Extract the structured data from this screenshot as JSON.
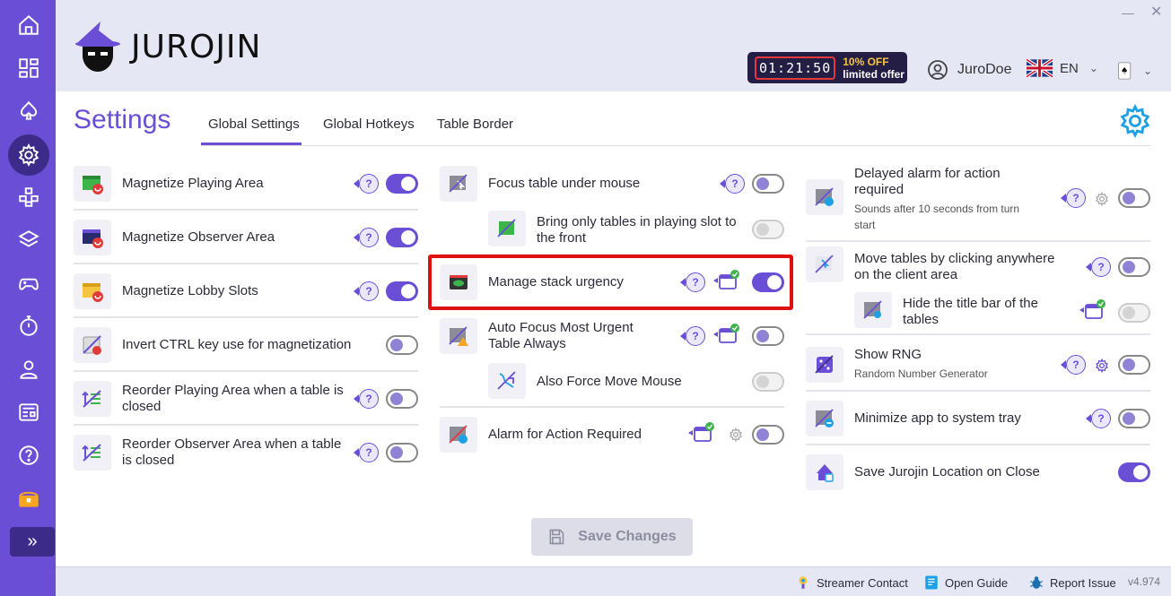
{
  "app": {
    "logo_text": "JUROJIN"
  },
  "window": {
    "minimize": "—",
    "close": "✕"
  },
  "promo": {
    "timer": "01:21:50",
    "discount": "10% OFF",
    "subtitle": "limited offer"
  },
  "user": {
    "name": "JuroDoe",
    "icon": "user-circle-icon"
  },
  "language": {
    "code": "EN",
    "flag": "uk-flag-icon",
    "chevron": "⌄"
  },
  "sidebar": {
    "items": [
      {
        "icon": "home-icon"
      },
      {
        "icon": "dashboard-icon"
      },
      {
        "icon": "spade-icon"
      },
      {
        "icon": "gear-icon",
        "active": true
      },
      {
        "icon": "layout-icon"
      },
      {
        "icon": "layers-icon"
      },
      {
        "icon": "gamepad-icon"
      },
      {
        "icon": "stopwatch-icon"
      },
      {
        "icon": "person-icon"
      },
      {
        "icon": "news-icon"
      },
      {
        "icon": "help-icon"
      },
      {
        "icon": "treasure-chest-icon"
      }
    ],
    "expand_label": "»"
  },
  "page": {
    "title": "Settings",
    "tabs": [
      {
        "label": "Global Settings",
        "active": true
      },
      {
        "label": "Global Hotkeys"
      },
      {
        "label": "Table Border"
      }
    ]
  },
  "settings": {
    "col1": [
      {
        "label": "Magnetize Playing Area",
        "state": "on"
      },
      {
        "label": "Magnetize Observer Area",
        "state": "on"
      },
      {
        "label": "Magnetize Lobby Slots",
        "state": "on"
      },
      {
        "label": "Invert CTRL key use for magnetization",
        "state": "off"
      },
      {
        "label": "Reorder Playing Area when a table is closed",
        "state": "off"
      },
      {
        "label": "Reorder Observer Area when a table is closed",
        "state": "off"
      }
    ],
    "col2": [
      {
        "label": "Focus table under mouse",
        "state": "off"
      },
      {
        "label": "Bring only tables in playing slot to the front",
        "state": "disabled"
      },
      {
        "label": "Manage stack urgency",
        "state": "on"
      },
      {
        "label": "Auto Focus Most Urgent Table Always",
        "state": "off"
      },
      {
        "label": "Also Force Move Mouse",
        "state": "disabled"
      },
      {
        "label": "Alarm for Action Required",
        "state": "off"
      }
    ],
    "col3": [
      {
        "label": "Delayed alarm for action required",
        "sub": "Sounds after 10 seconds from turn start",
        "state": "off"
      },
      {
        "label": "Move tables by clicking anywhere on the client area",
        "state": "off"
      },
      {
        "label": "Hide the title bar of the tables",
        "state": "disabled"
      },
      {
        "label": "Show RNG",
        "sub": "Random Number Generator",
        "state": "off"
      },
      {
        "label": "Minimize app to system tray",
        "state": "off"
      },
      {
        "label": "Save Jurojin Location on Close",
        "state": "on"
      }
    ],
    "help_label": "?"
  },
  "save_button": {
    "label": "Save Changes",
    "enabled": false
  },
  "footer": {
    "streamer": "Streamer Contact",
    "guide": "Open Guide",
    "report": "Report Issue",
    "version": "v4.974"
  },
  "colors": {
    "accent": "#6a4fd6",
    "highlight": "#e01010",
    "promo_bg": "#241e45"
  }
}
